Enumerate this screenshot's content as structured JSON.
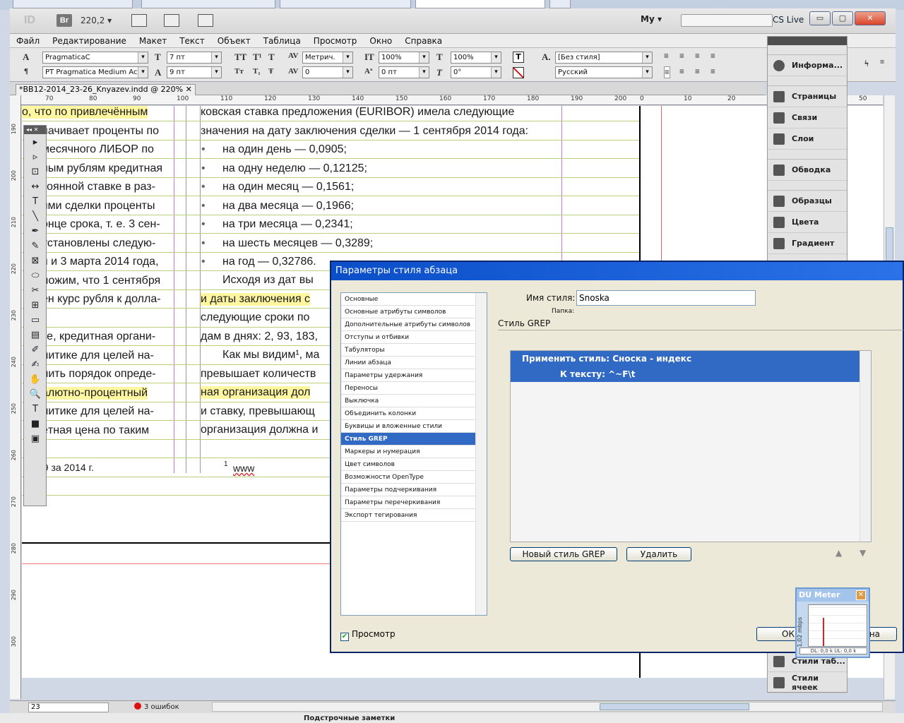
{
  "browser_tabs": [
    "",
    "",
    "",
    "",
    ""
  ],
  "app": {
    "logo": "ID",
    "bridge": "Br",
    "zoom": "220,2",
    "workspace": "My",
    "search_placeholder": "",
    "cs_live": "CS Live"
  },
  "window_buttons": {
    "minimize": "▭",
    "restore": "▢",
    "close": "✕"
  },
  "menu": [
    "Файл",
    "Редактирование",
    "Макет",
    "Текст",
    "Объект",
    "Таблица",
    "Просмотр",
    "Окно",
    "Справка"
  ],
  "control": {
    "font_family": "PragmaticaC",
    "font_style": "PT Pragmatica Medium Accent",
    "font_size": "7 пт",
    "leading": "9 пт",
    "kerning": "Метрич.",
    "tracking": "0",
    "vscale": "100%",
    "hscale": "100%",
    "baseline_shift": "0 пт",
    "skew": "0°",
    "char_style": "[Без стиля]",
    "language": "Русский"
  },
  "document": {
    "tab_label": "*BB12-2014_23-26_Knyazev.indd @ 220%",
    "close_glyph": "✕"
  },
  "ruler_h": [
    "70",
    "80",
    "90",
    "100",
    "110",
    "120",
    "130",
    "140",
    "150",
    "160",
    "170",
    "180",
    "190",
    "200",
    "0",
    "10",
    "20",
    "30",
    "40",
    "50"
  ],
  "ruler_v": [
    "190",
    "200",
    "210",
    "220",
    "230",
    "240",
    "250",
    "260",
    "270",
    "280",
    "290",
    "300"
  ],
  "page_text": {
    "left_col": [
      "о, что по привлечённым",
      "начивает проценты по",
      "месячного ЛИБОР по",
      "ным рублям кредитная",
      "тоянной ставке в раз-",
      "ями сделки проценты",
      "онце срока, т. е. 3 сен-",
      "установлены следую-",
      "я и 3 марта 2014 года,",
      "ложим, что 1 сентября",
      "ен курс рубля к долла-",
      "",
      "ке, кредитная органи-",
      "литике для целей на-",
      "лить порядок опреде-",
      "алютно-процентный",
      "литике для целей на-",
      "ётная цена по таким"
    ],
    "left_footer": ", 9 за 2014 г.",
    "right_col": [
      "ковская ставка предложения (EURIBOR) имела следующие",
      "значения на дату заключения сделки — 1 сентября 2014 года:"
    ],
    "bullets": [
      "на один день — 0,0905;",
      "на одну неделю — 0,12125;",
      "на один месяц — 0,1561;",
      "на два месяца — 0,1966;",
      "на три месяца — 0,2341;",
      "на шесть месяцев — 0,3289;",
      "на год — 0,32786."
    ],
    "right_more": [
      "Исходя из дат вы",
      "и даты заключения с",
      "следующие сроки по",
      "дам в днях: 2, 93, 183,",
      "Как мы видим¹, ма",
      "превышает количеств",
      "ная организация дол",
      "и ставку, превышающ",
      "организация должна и"
    ],
    "footnote_num": "1",
    "footnote_text": "www"
  },
  "tools": [
    "▸",
    "▹",
    "⊡",
    "↔",
    "T",
    "╲",
    "✒",
    "✎",
    "⊠",
    "⬭",
    "✂",
    "⊞",
    "▭",
    "▤",
    "✐",
    "✍",
    "✋",
    "🔍",
    "T",
    "■",
    "▣"
  ],
  "right_panel": {
    "info": "Информа...",
    "items": [
      "Страницы",
      "Связи",
      "Слои",
      "Обводка",
      "Образцы",
      "Цвета",
      "Градиент"
    ],
    "bottom_items": [
      "Стили таб...",
      "Стили ячеек"
    ]
  },
  "status": {
    "page": "23",
    "errors": "3 ошибок"
  },
  "bottom_strip": "Подстрочные заметки",
  "dialog": {
    "title": "Параметры стиля абзаца",
    "categories": [
      "Основные",
      "Основные атрибуты символов",
      "Дополнительные атрибуты символов",
      "Отступы и отбивки",
      "Табуляторы",
      "Линии абзаца",
      "Параметры удержания",
      "Переносы",
      "Выключка",
      "Объединить колонки",
      "Буквицы и вложенные стили",
      "Стиль GREP",
      "Маркеры и нумерация",
      "Цвет символов",
      "Возможности OpenType",
      "Параметры подчеркивания",
      "Параметры перечеркивания",
      "Экспорт тегирования"
    ],
    "selected_index": 11,
    "style_name_label": "Имя стиля:",
    "style_name_value": "Snoska",
    "folder_label": "Папка:",
    "section_title": "Стиль GREP",
    "grep_apply": "Применить стиль: Сноска - индекс",
    "grep_to": "К тексту: ^~F\\t",
    "new_grep_button": "Новый стиль GREP",
    "delete_button": "Удалить",
    "up_arrow": "▲",
    "down_arrow": "▼",
    "preview_label": "Просмотр",
    "preview_checked": true,
    "ok_button": "ОК",
    "cancel_button": "Отмена"
  },
  "du_meter": {
    "title": "DU Meter",
    "scale": "1,02 mbps",
    "footer": "DL: 0,0 k   UL: 0,0 k"
  }
}
